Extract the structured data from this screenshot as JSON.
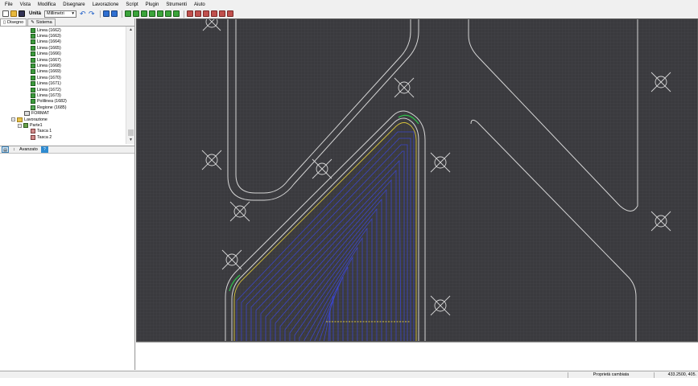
{
  "menu": [
    "File",
    "Vista",
    "Modifica",
    "Disegnare",
    "Lavorazione",
    "Script",
    "Plugin",
    "Strumenti",
    "Aiuto"
  ],
  "toolbar": {
    "units_label": "Unità",
    "units_value": "Millimetri"
  },
  "tabs": [
    "Disegno",
    "Sistema"
  ],
  "tree": {
    "lines": [
      "Linea (1662)",
      "Linea (1663)",
      "Linea (1664)",
      "Linea (1665)",
      "Linea (1666)",
      "Linea (1667)",
      "Linea (1668)",
      "Linea (1669)",
      "Linea (1670)",
      "Linea (1671)",
      "Linea (1672)",
      "Linea (1673)"
    ],
    "polyline": "Polilinea (1682)",
    "region": "Regione (1685)",
    "format": "FORMAT",
    "machining": "Lavorazione",
    "part": "Parte1",
    "pocket1": "Tasca 1",
    "pocket2": "Tasca 2"
  },
  "properties": {
    "advanced_label": "Avanzato"
  },
  "status": {
    "message": "Proprietà cambiata",
    "coords": "433.2500, 405."
  },
  "colors": {
    "canvas_bg": "#3a3a3e",
    "geometry": "#d6d6d6",
    "toolpath": "#3b46c9",
    "offset": "#d9c43b",
    "entry": "#2ec24a"
  }
}
